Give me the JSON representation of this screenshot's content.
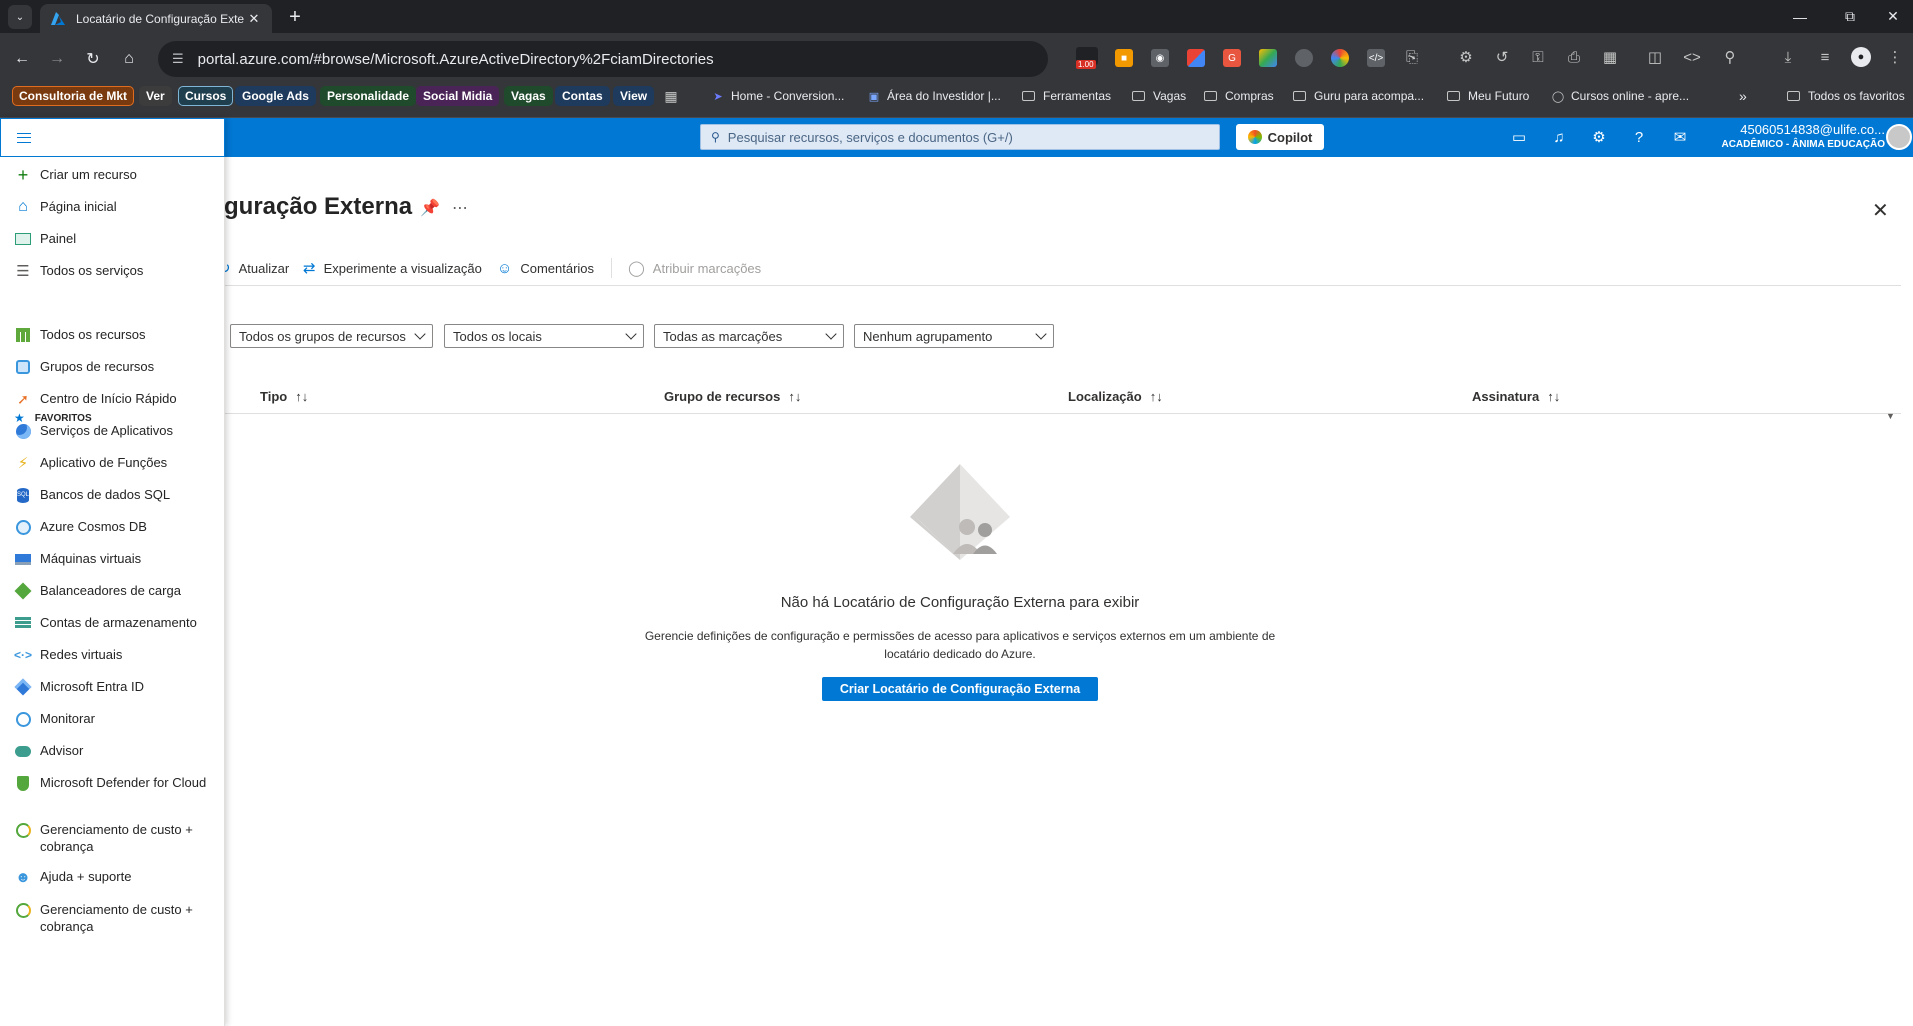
{
  "browser": {
    "tab_title": "Locatário de Configuração Exte",
    "url": "portal.azure.com/#browse/Microsoft.AzureActiveDirectory%2FciamDirectories",
    "ext_badge": "1.00"
  },
  "bookmarks": {
    "chips": [
      {
        "label": "Consultoria de Mkt",
        "color": "#7a3a10",
        "border": "#e06d1f"
      },
      {
        "label": "Ver",
        "color": "#3c3c3c",
        "border": "#3c3c3c"
      },
      {
        "label": "Cursos",
        "color": "#1f3f4f",
        "border": "#7fb6d6"
      },
      {
        "label": "Google Ads",
        "color": "#1e3a5c",
        "border": "#1e3a5c"
      },
      {
        "label": "Personalidade",
        "color": "#1f4a2b",
        "border": "#1f4a2b"
      },
      {
        "label": "Social Midia",
        "color": "#4a2457",
        "border": "#4a2457"
      },
      {
        "label": "Vagas",
        "color": "#1f4a2b",
        "border": "#1f4a2b"
      },
      {
        "label": "Contas",
        "color": "#1e3a5c",
        "border": "#1e3a5c"
      },
      {
        "label": "View",
        "color": "#1e3a5c",
        "border": "#1e3a5c"
      }
    ],
    "links": [
      "Home - Conversion...",
      "Área do Investidor |...",
      "Ferramentas",
      "Vagas",
      "Compras",
      "Guru para acompa...",
      "Meu Futuro",
      "Cursos online - apre..."
    ],
    "all_favorites": "Todos os favoritos"
  },
  "header": {
    "search_placeholder": "Pesquisar recursos, serviços e documentos (G+/)",
    "copilot": "Copilot",
    "account_email": "45060514838@ulife.co...",
    "account_org": "ACADÊMICO - ÂNIMA EDUCAÇÃO"
  },
  "menu": {
    "items_top": [
      {
        "label": "Criar um recurso",
        "icon": "plus-icon",
        "color": "#107c10"
      },
      {
        "label": "Página inicial",
        "icon": "home-icon",
        "color": "#0078d4"
      },
      {
        "label": "Painel",
        "icon": "dashboard-icon",
        "color": "#2d9d78"
      },
      {
        "label": "Todos os serviços",
        "icon": "list-icon",
        "color": "#605e5c"
      }
    ],
    "favorites_label": "FAVORITOS",
    "favorites": [
      {
        "label": "Todos os recursos",
        "icon": "grid-icon",
        "color": "#5ea83c"
      },
      {
        "label": "Grupos de recursos",
        "icon": "resource-group-icon",
        "color": "#3a96dd"
      },
      {
        "label": "Centro de Início Rápido",
        "icon": "rocket-icon",
        "color": "#e86f24"
      },
      {
        "label": "Serviços de Aplicativos",
        "icon": "app-service-icon",
        "color": "#2f7ad9"
      },
      {
        "label": "Aplicativo de Funções",
        "icon": "function-icon",
        "color": "#e8b21b"
      },
      {
        "label": "Bancos de dados SQL",
        "icon": "sql-icon",
        "color": "#2469c7"
      },
      {
        "label": "Azure Cosmos DB",
        "icon": "cosmos-icon",
        "color": "#3a96dd"
      },
      {
        "label": "Máquinas virtuais",
        "icon": "vm-icon",
        "color": "#2f7ad9"
      },
      {
        "label": "Balanceadores de carga",
        "icon": "load-balancer-icon",
        "color": "#54a73c"
      },
      {
        "label": "Contas de armazenamento",
        "icon": "storage-icon",
        "color": "#3c9d8f"
      },
      {
        "label": "Redes virtuais",
        "icon": "vnet-icon",
        "color": "#3a96dd"
      },
      {
        "label": "Microsoft Entra ID",
        "icon": "entra-icon",
        "color": "#2f7ad9"
      },
      {
        "label": "Monitorar",
        "icon": "monitor-icon",
        "color": "#3a96dd"
      },
      {
        "label": "Advisor",
        "icon": "advisor-icon",
        "color": "#3c9d8f"
      },
      {
        "label": "Microsoft Defender for Cloud",
        "icon": "defender-icon",
        "color": "#54a73c"
      },
      {
        "label": "Gerenciamento de custo + cobrança",
        "icon": "cost-icon",
        "color": "#54a73c"
      },
      {
        "label": "Ajuda + suporte",
        "icon": "help-support-icon",
        "color": "#3a96dd"
      },
      {
        "label": "Gerenciamento de custo + cobrança",
        "icon": "cost-icon",
        "color": "#54a73c"
      }
    ]
  },
  "blade": {
    "title": "guração Externa",
    "commands": {
      "refresh": "Atualizar",
      "preview": "Experimente a visualização",
      "feedback": "Comentários",
      "tags": "Atribuir marcações"
    },
    "filters": [
      "Todos os grupos de recursos",
      "Todos os locais",
      "Todas as marcações",
      "Nenhum agrupamento"
    ],
    "columns": [
      "Tipo",
      "Grupo de recursos",
      "Localização",
      "Assinatura"
    ],
    "empty": {
      "title": "Não há Locatário de Configuração Externa para exibir",
      "description": "Gerencie definições de configuração e permissões de acesso para aplicativos e serviços externos em um ambiente de locatário dedicado do Azure.",
      "button": "Criar Locatário de Configuração Externa"
    }
  }
}
